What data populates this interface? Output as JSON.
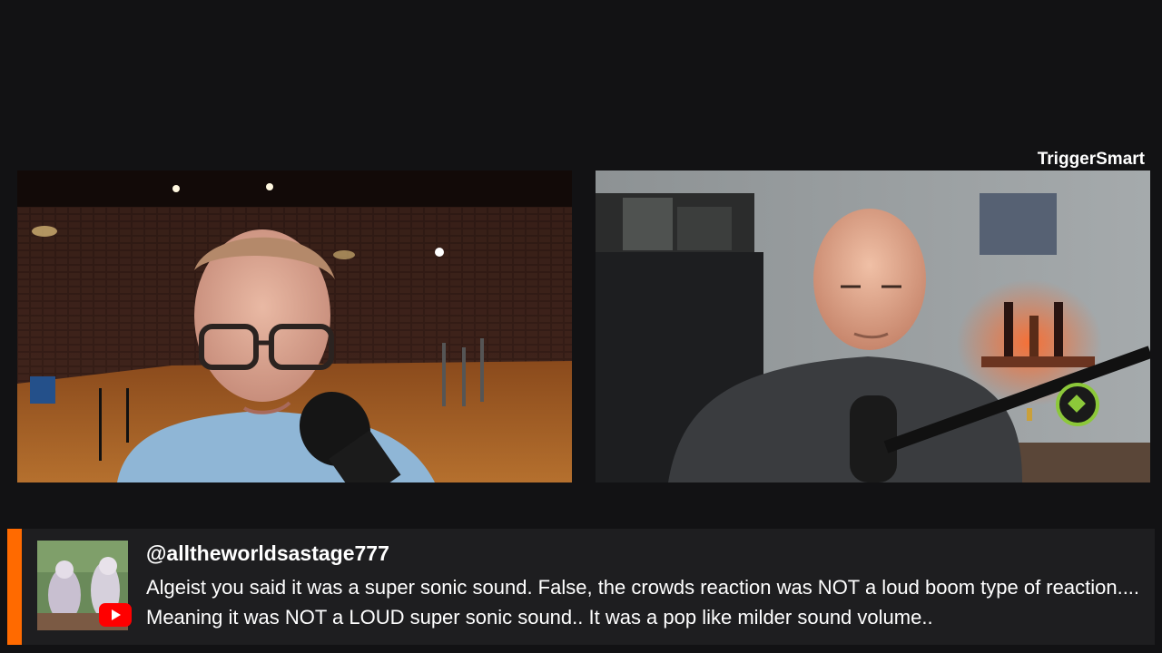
{
  "stream": {
    "host_name": "TriggerSmart"
  },
  "comment": {
    "username": "@alltheworldsastage777",
    "text": "Algeist you said it was a super sonic sound. False, the crowds reaction was NOT a loud boom type of reaction.... Meaning it was NOT a LOUD super sonic sound.. It was a pop like milder sound volume..",
    "platform_icon": "youtube-icon",
    "accent_color": "#ff6a00"
  }
}
